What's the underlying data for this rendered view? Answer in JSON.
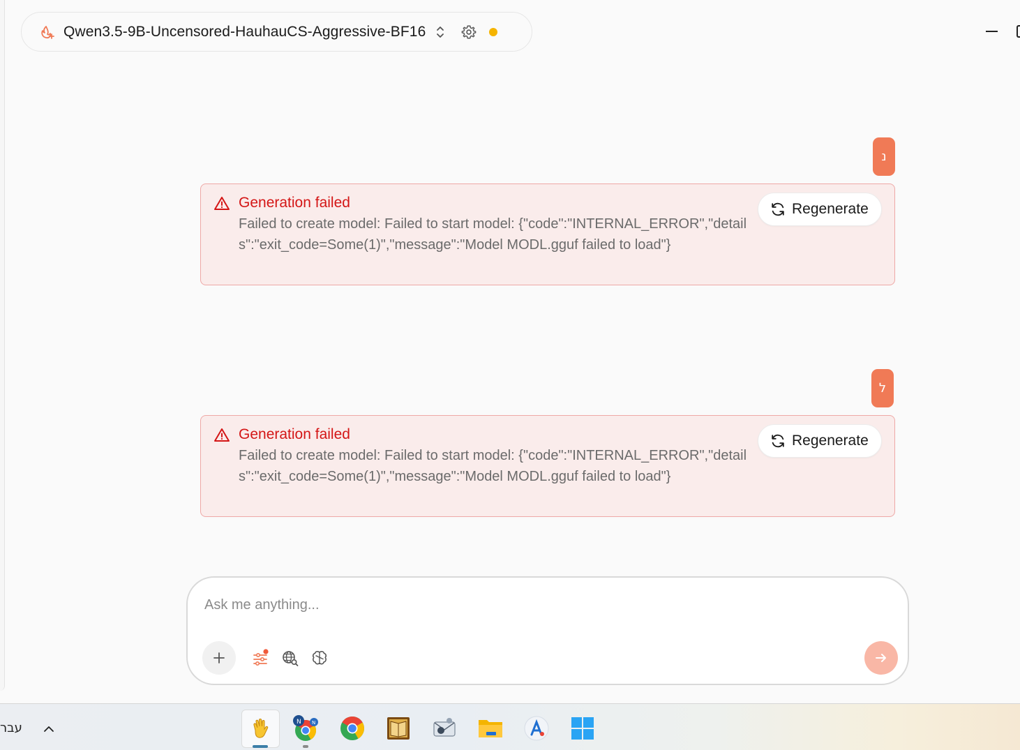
{
  "header": {
    "model_name": "Qwen3.5-9B-Uncensored-HauhauCS-Aggressive-BF16",
    "status_color": "#f5b400",
    "logo_icon": "flame-spark-icon",
    "switch_icon": "chevron-up-down-icon",
    "settings_icon": "gear-icon"
  },
  "window_controls": {
    "minimize_icon": "minimize-icon",
    "maximize_icon": "maximize-icon"
  },
  "colors": {
    "accent": "#f07a56",
    "error_title": "#d41616",
    "error_border": "#eea8a6",
    "error_bg": "#faeceb",
    "send_disabled": "#f9b7a6"
  },
  "conversation": [
    {
      "user_initial": "נ",
      "error": {
        "title": "Generation failed",
        "message": "Failed to create model: Failed to start model: {\"code\":\"INTERNAL_ERROR\",\"details\":\"exit_code=Some(1)\",\"message\":\"Model MODL.gguf failed to load\"}",
        "action_label": "Regenerate"
      }
    },
    {
      "user_initial": "ל",
      "error": {
        "title": "Generation failed",
        "message": "Failed to create model: Failed to start model: {\"code\":\"INTERNAL_ERROR\",\"details\":\"exit_code=Some(1)\",\"message\":\"Model MODL.gguf failed to load\"}",
        "action_label": "Regenerate"
      }
    }
  ],
  "composer": {
    "placeholder": "Ask me anything...",
    "tools": [
      "plus-icon",
      "sliders-icon",
      "web-search-icon",
      "brain-icon"
    ],
    "send_icon": "arrow-right-icon"
  },
  "taskbar": {
    "language": "עבר",
    "apps": [
      "waving-hand-app",
      "chrome-profile-app",
      "chrome-app",
      "book-app",
      "mail-app",
      "file-explorer-app",
      "app-store-app",
      "windows-start-app"
    ]
  }
}
